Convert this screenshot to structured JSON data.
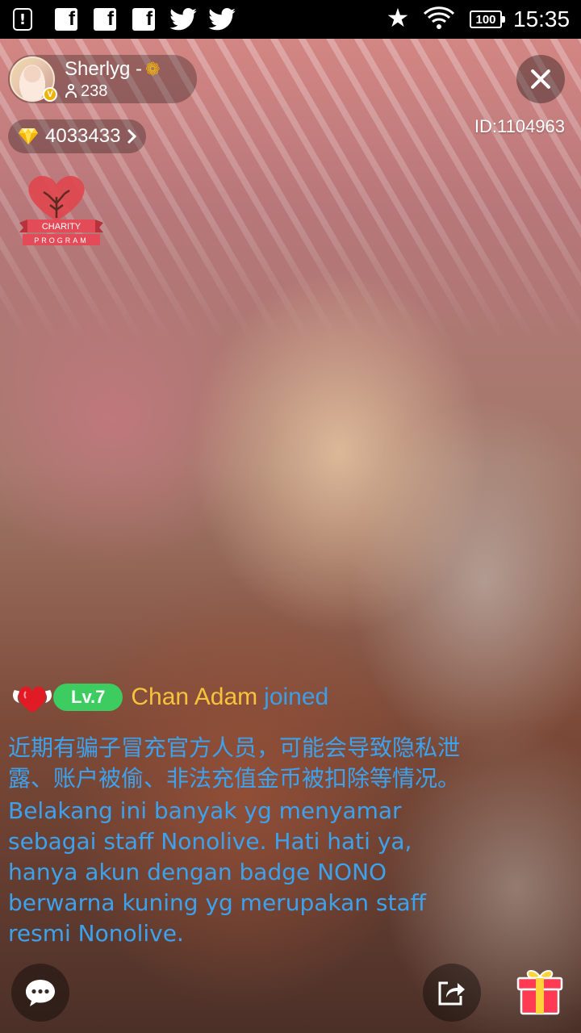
{
  "status_bar": {
    "time": "15:35",
    "battery": "100",
    "icons": [
      "alert-icon",
      "facebook-icon",
      "facebook-icon",
      "facebook-icon",
      "twitter-icon",
      "twitter-icon",
      "star-icon",
      "wifi-icon",
      "battery-icon"
    ]
  },
  "host": {
    "name": "Sherlyg -",
    "emoji": "❁",
    "verified_badge": "V",
    "viewers": "238"
  },
  "room": {
    "id_label": "ID:1104963"
  },
  "diamonds": {
    "count": "4033433"
  },
  "charity": {
    "line1": "CHARITY",
    "line2": "PROGRAM"
  },
  "chat": {
    "join": {
      "level": "Lv.7",
      "user": "Chan Adam",
      "action": "joined"
    },
    "notice_zh": "近期有骗子冒充官方人员，可能会导致隐私泄露、账户被偷、非法充值金币被扣除等情况。",
    "notice_id": "Belakang ini banyak yg menyamar sebagai staff Nonolive. Hati hati ya, hanya akun dengan badge NONO berwarna kuning yg merupakan staff resmi Nonolive."
  },
  "colors": {
    "level_badge": "#3dcc5f",
    "join_user": "#f7c33c",
    "chat_text": "#3da2ee",
    "verified": "#f2b300"
  }
}
